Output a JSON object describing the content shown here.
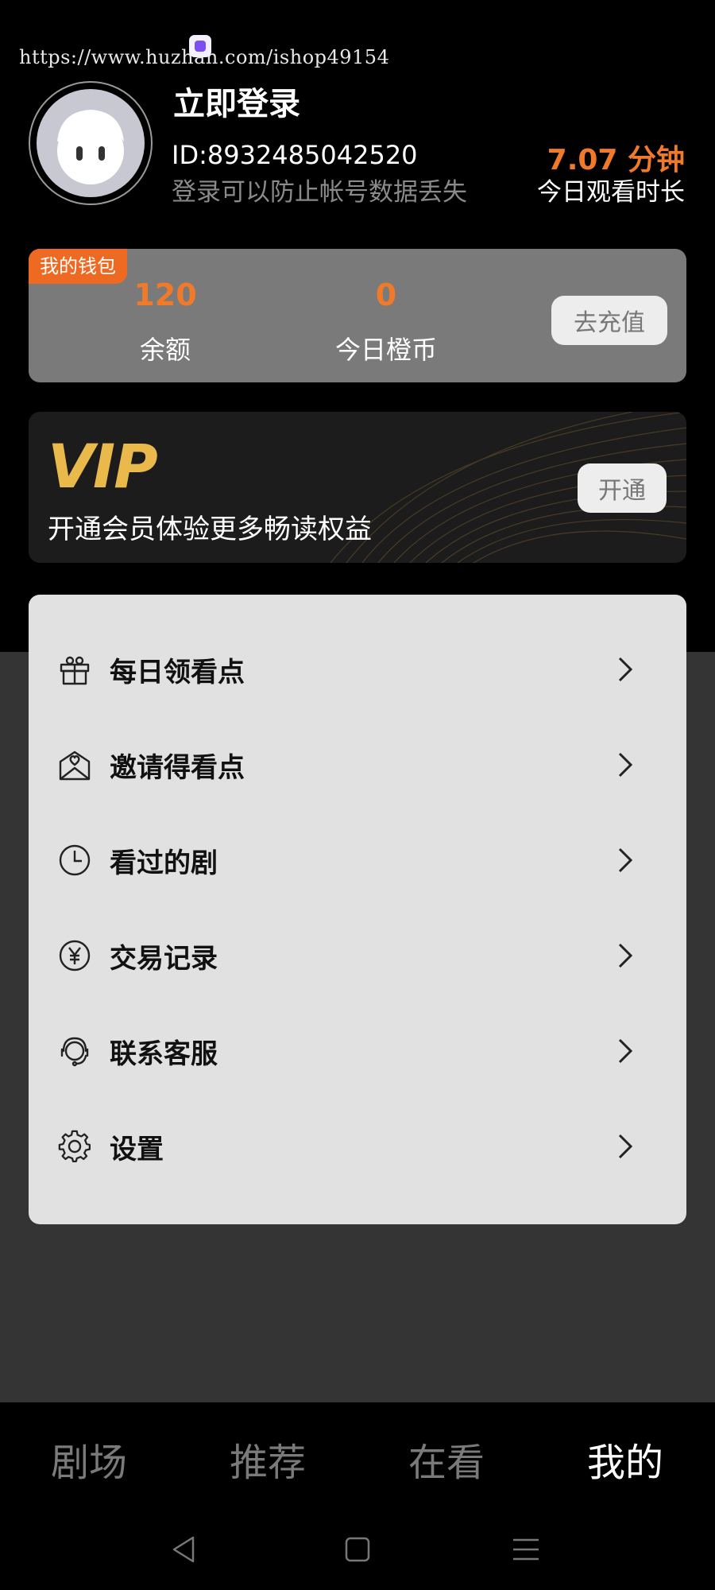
{
  "watermark": "https://www.huzhan.com/ishop49154",
  "profile": {
    "login_title": "立即登录",
    "user_id": "ID:8932485042520",
    "login_hint": "登录可以防止帐号数据丢失",
    "watch_time_value": "7.07 分钟",
    "watch_time_label": "今日观看时长"
  },
  "wallet": {
    "tag": "我的钱包",
    "balance_value": "120",
    "balance_label": "余额",
    "coins_value": "0",
    "coins_label": "今日橙币",
    "recharge_button": "去充值"
  },
  "vip": {
    "logo": "VIP",
    "text": "开通会员体验更多畅读权益",
    "open_button": "开通"
  },
  "menu": {
    "items": [
      {
        "label": "每日领看点",
        "icon": "gift-icon"
      },
      {
        "label": "邀请得看点",
        "icon": "invite-envelope-icon"
      },
      {
        "label": "看过的剧",
        "icon": "clock-icon"
      },
      {
        "label": "交易记录",
        "icon": "yuan-coin-icon"
      },
      {
        "label": "联系客服",
        "icon": "customer-service-icon"
      },
      {
        "label": "设置",
        "icon": "gear-icon"
      }
    ]
  },
  "tabs": [
    {
      "label": "剧场",
      "active": false
    },
    {
      "label": "推荐",
      "active": false
    },
    {
      "label": "在看",
      "active": false
    },
    {
      "label": "我的",
      "active": true
    }
  ],
  "colors": {
    "accent": "#f07a2a",
    "wallet_tag": "#ee6a22",
    "vip_gold": "#e9b94c",
    "menu_bg": "#e1e1e1"
  }
}
